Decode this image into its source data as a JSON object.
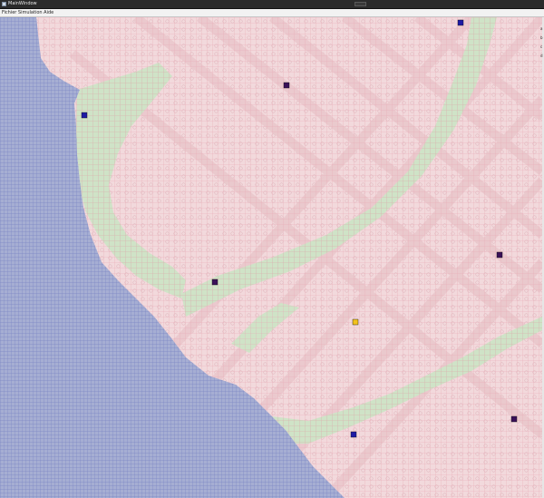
{
  "window": {
    "title": "MainWindow",
    "menu_label": "Fichier   Simulation   Aide"
  },
  "map": {
    "colors": {
      "water": "#a6aed3",
      "land": "#f2d9dc",
      "road": "#eac9cd",
      "park": "#cfe3c7",
      "grid_land": "#e8a7b3",
      "grid_water": "#7c86c3",
      "grid_park": "#a9c99e",
      "buildings": "#d8a8b0",
      "marker_blue": "#1e1aa4",
      "marker_dark": "#3a1058",
      "marker_yellow": "#f2c21f"
    },
    "markers": [
      {
        "id": "m1",
        "type": "blue",
        "icon": "square-marker"
      },
      {
        "id": "m2",
        "type": "dark",
        "icon": "square-marker"
      },
      {
        "id": "m3",
        "type": "blue",
        "icon": "square-marker"
      },
      {
        "id": "m4",
        "type": "dark",
        "icon": "square-marker"
      },
      {
        "id": "m5",
        "type": "yellow",
        "icon": "square-marker"
      },
      {
        "id": "m6",
        "type": "dark",
        "icon": "square-marker"
      },
      {
        "id": "m7",
        "type": "dark",
        "icon": "square-marker"
      },
      {
        "id": "m8",
        "type": "blue",
        "icon": "square-marker"
      }
    ]
  },
  "side_letters": [
    "a",
    "b",
    "c",
    "d"
  ]
}
